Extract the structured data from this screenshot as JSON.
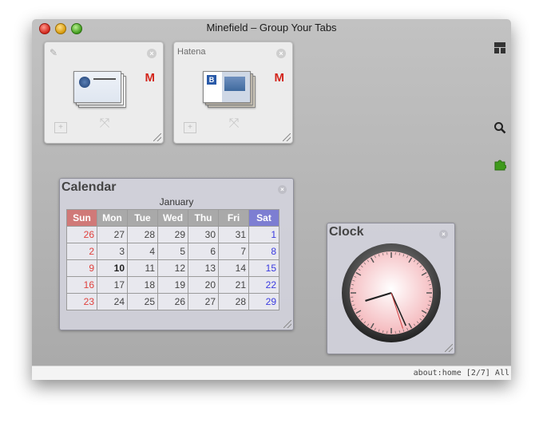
{
  "window": {
    "title": "Minefield – Group Your Tabs"
  },
  "tab_groups": [
    {
      "name": "",
      "has_gmail_tab": true
    },
    {
      "name": "Hatena",
      "has_gmail_tab": true
    }
  ],
  "side_icons": [
    "tab-grid-icon",
    "search-icon",
    "puzzle-piece-icon"
  ],
  "calendar": {
    "title": "Calendar",
    "month": "January",
    "weekdays": [
      "Sun",
      "Mon",
      "Tue",
      "Wed",
      "Thu",
      "Fri",
      "Sat"
    ],
    "weeks": [
      [
        "26",
        "27",
        "28",
        "29",
        "30",
        "31",
        "1"
      ],
      [
        "2",
        "3",
        "4",
        "5",
        "6",
        "7",
        "8"
      ],
      [
        "9",
        "10",
        "11",
        "12",
        "13",
        "14",
        "15"
      ],
      [
        "16",
        "17",
        "18",
        "19",
        "20",
        "21",
        "22"
      ],
      [
        "23",
        "24",
        "25",
        "26",
        "27",
        "28",
        "29"
      ]
    ],
    "today": "10"
  },
  "clock": {
    "title": "Clock",
    "hour": 8,
    "minute": 26,
    "second": 27
  },
  "status": {
    "text": "about:home [2/7] All"
  },
  "colors": {
    "sunday": "#e0413d",
    "saturday": "#3b3be0",
    "gmail": "#d3251b"
  }
}
